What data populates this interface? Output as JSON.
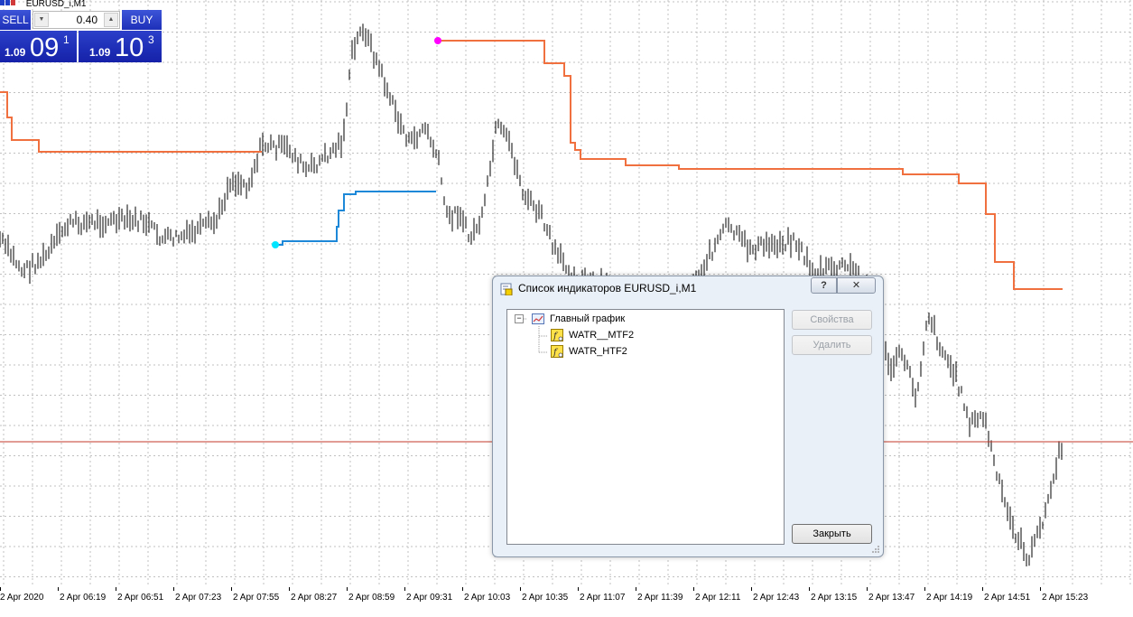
{
  "chart": {
    "symbol_title": "EURUSD_i,M1",
    "time_labels": [
      "2 Apr 2020",
      "2 Apr 06:19",
      "2 Apr 06:51",
      "2 Apr 07:23",
      "2 Apr 07:55",
      "2 Apr 08:27",
      "2 Apr 08:59",
      "2 Apr 09:31",
      "2 Apr 10:03",
      "2 Apr 10:35",
      "2 Apr 11:07",
      "2 Apr 11:39",
      "2 Apr 12:11",
      "2 Apr 12:43",
      "2 Apr 13:15",
      "2 Apr 13:47",
      "2 Apr 14:19",
      "2 Apr 14:51",
      "2 Apr 15:23"
    ],
    "colors": {
      "candles": "#000000",
      "indicator_htf": "#f07040",
      "indicator_mtf": "#1e88d8",
      "bid_line": "#c0392b",
      "grid": "#c0c0c0",
      "marker_magenta": "#ff00ff",
      "marker_cyan": "#00e5ff"
    }
  },
  "trade_panel": {
    "sell_label": "SELL",
    "buy_label": "BUY",
    "lot_value": "0.40",
    "sell_price_prefix": "1.09",
    "sell_price_big": "09",
    "sell_price_sup": "1",
    "buy_price_prefix": "1.09",
    "buy_price_big": "10",
    "buy_price_sup": "3"
  },
  "dialog": {
    "title": "Список индикаторов EURUSD_i,M1",
    "help_label": "?",
    "tree": {
      "root": "Главный график",
      "items": [
        "WATR__MTF2",
        "WATR_HTF2"
      ]
    },
    "buttons": {
      "properties": "Свойства",
      "delete": "Удалить",
      "close": "Закрыть"
    }
  }
}
